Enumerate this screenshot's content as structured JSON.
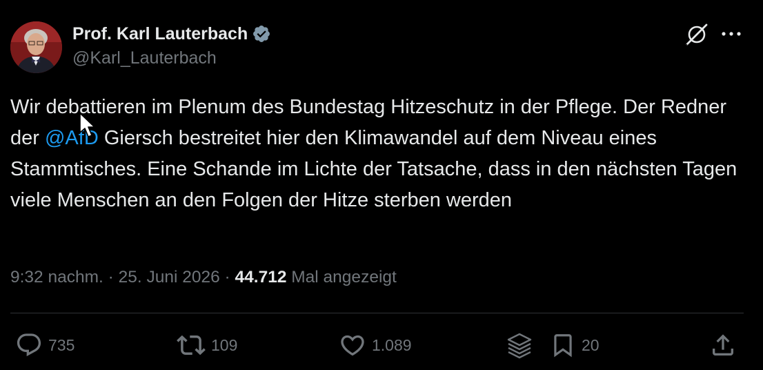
{
  "author": {
    "display_name": "Prof. Karl Lauterbach",
    "handle": "@Karl_Lauterbach",
    "verified": true,
    "verified_color": "#829aab"
  },
  "tweet": {
    "text_before_mention": "Wir debattieren im Plenum des Bundestag Hitzeschutz in der Pflege. Der Redner der ",
    "mention": "@AfD",
    "text_after_mention": " Giersch bestreitet hier den Klimawandel auf dem Niveau eines Stammtisches. Eine Schande im Lichte der Tatsache, dass in den nächsten Tagen viele Menschen an den Folgen der Hitze sterben werden",
    "mention_color": "#1d9bf0"
  },
  "meta": {
    "time": "9:32 nachm.",
    "separator": " · ",
    "date": "25. Juni 2026",
    "views_count": "44.712",
    "views_label": " Mal angezeigt"
  },
  "actions": {
    "replies": "735",
    "reposts": "109",
    "likes": "1.089",
    "bookmarks": "20"
  },
  "icons": {
    "header": [
      "grok-icon",
      "more-icon"
    ],
    "actions": [
      "reply-icon",
      "repost-icon",
      "like-icon",
      "stack-icon",
      "bookmark-icon",
      "share-icon"
    ]
  },
  "colors": {
    "background": "#000000",
    "text": "#e7e9ea",
    "secondary": "#71767b",
    "divider": "#2f3336"
  }
}
